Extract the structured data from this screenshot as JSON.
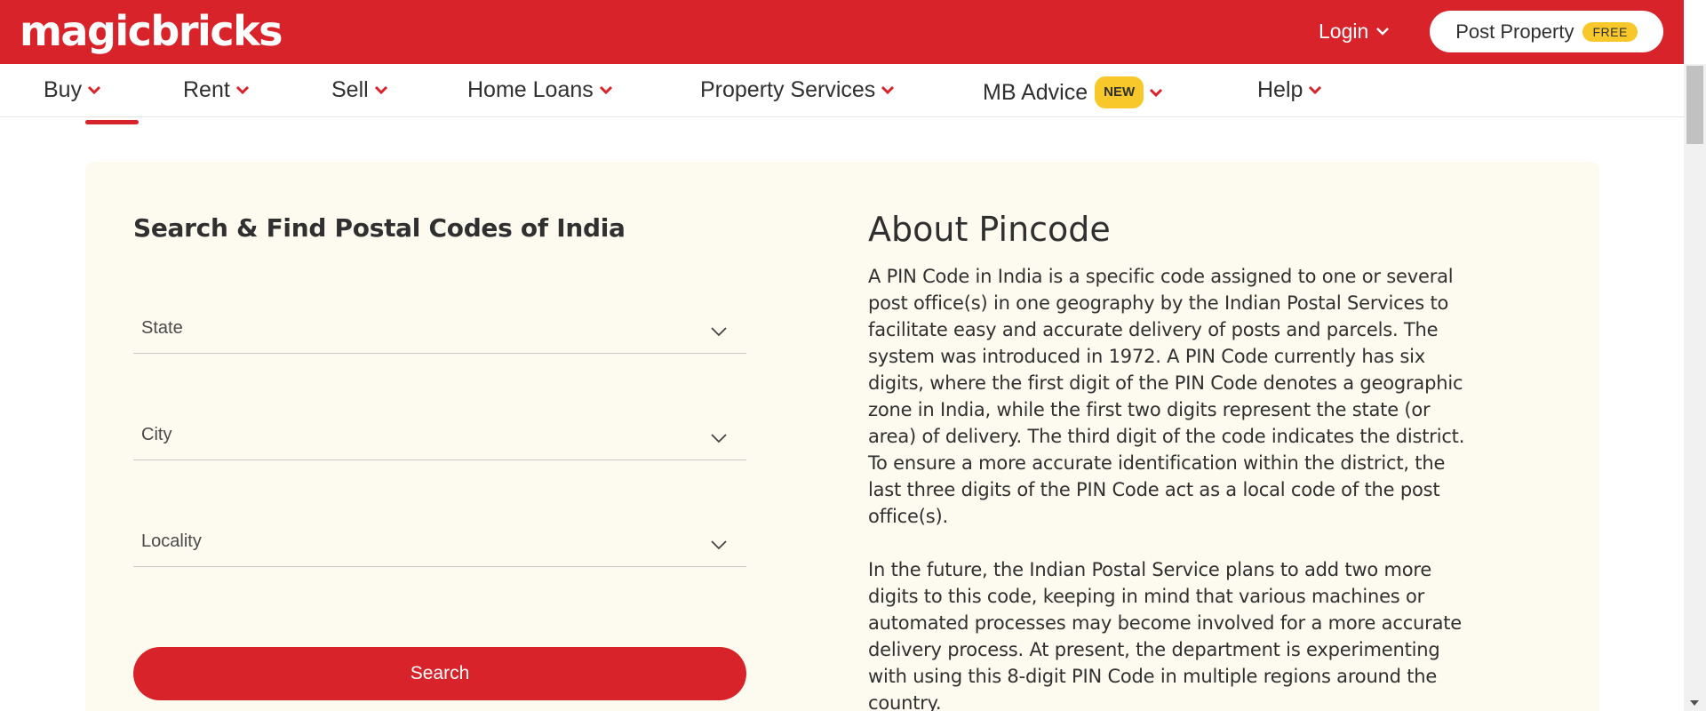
{
  "header": {
    "logo": "magicbricks",
    "login_label": "Login",
    "post_property_label": "Post Property",
    "free_badge": "FREE",
    "brand_color": "#d8232a",
    "badge_color": "#f8c82b"
  },
  "nav": {
    "items": [
      {
        "label": "Buy"
      },
      {
        "label": "Rent"
      },
      {
        "label": "Sell"
      },
      {
        "label": "Home Loans"
      },
      {
        "label": "Property Services"
      },
      {
        "label": "MB Advice",
        "badge": "NEW"
      },
      {
        "label": "Help"
      }
    ],
    "active": "Buy"
  },
  "search_form": {
    "title": "Search & Find Postal Codes of India",
    "state_placeholder": "State",
    "city_placeholder": "City",
    "locality_placeholder": "Locality",
    "search_button": "Search"
  },
  "about": {
    "title": "About Pincode",
    "paragraph_1": "A PIN Code in India is a specific code assigned to one or several post office(s) in one geography by the Indian Postal Services to facilitate easy and accurate delivery of posts and parcels. The system was introduced in 1972. A PIN Code currently has six digits, where the first digit of the PIN Code denotes a geographic zone in India, while the first two digits represent the state (or area) of delivery. The third digit of the code indicates the district. To ensure a more accurate identification within the district, the last three digits of the PIN Code act as a local code of the post office(s).",
    "paragraph_2": "In the future, the Indian Postal Service plans to add two more digits to this code, keeping in mind that various machines or automated processes may become involved for a more accurate delivery process. At present, the department is experimenting with using this 8-digit PIN Code in multiple regions around the country."
  }
}
